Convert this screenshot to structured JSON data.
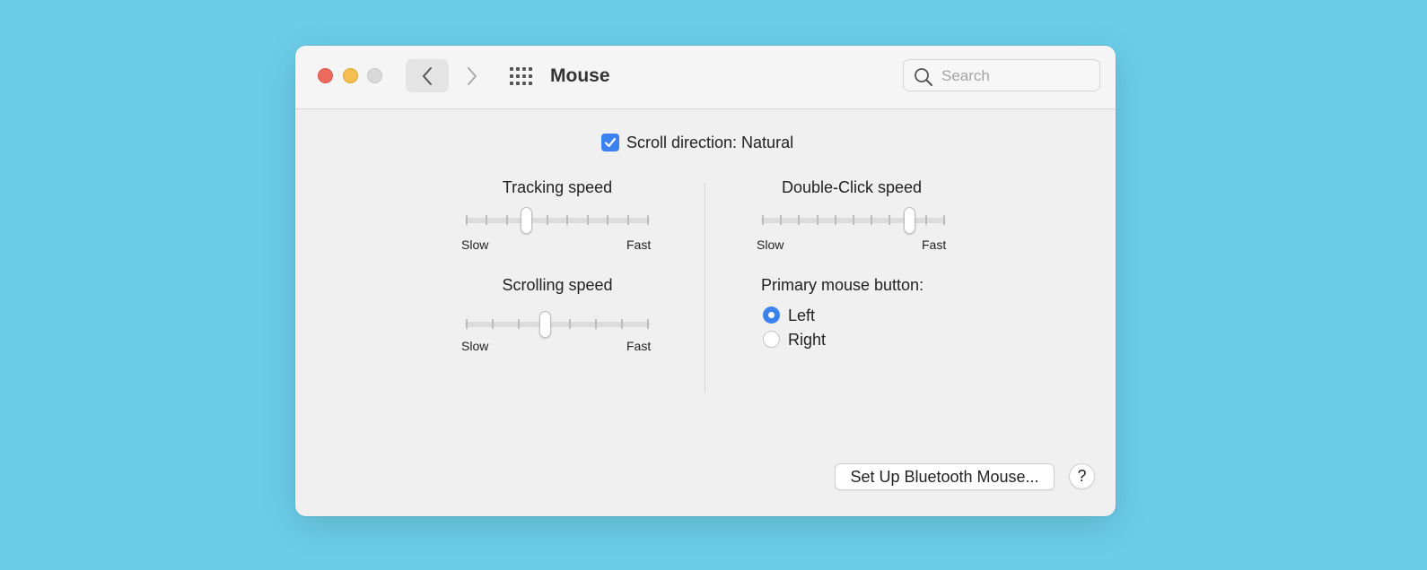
{
  "window": {
    "title": "Mouse",
    "search": {
      "placeholder": "Search",
      "value": ""
    },
    "traffic_lights": [
      "close",
      "minimize",
      "zoom-disabled"
    ],
    "nav": {
      "back_icon": "chevron-left-icon",
      "forward_icon": "chevron-right-icon",
      "show_all_icon": "grid-icon"
    }
  },
  "scroll_direction": {
    "label": "Scroll direction: Natural",
    "checked": true
  },
  "tracking_speed": {
    "label": "Tracking speed",
    "min_label": "Slow",
    "max_label": "Fast",
    "ticks": 10,
    "value_fraction": 0.33
  },
  "scrolling_speed": {
    "label": "Scrolling speed",
    "min_label": "Slow",
    "max_label": "Fast",
    "ticks": 8,
    "value_fraction": 0.43
  },
  "double_click_speed": {
    "label": "Double-Click speed",
    "min_label": "Slow",
    "max_label": "Fast",
    "ticks": 11,
    "value_fraction": 0.8
  },
  "primary_button": {
    "label": "Primary mouse button:",
    "options": [
      {
        "label": "Left",
        "selected": true
      },
      {
        "label": "Right",
        "selected": false
      }
    ]
  },
  "footer": {
    "setup_button": "Set Up Bluetooth Mouse...",
    "help_button": "?"
  },
  "colors": {
    "background": "#6ccde8",
    "accent": "#3b82f0",
    "close": "#ee6a5f",
    "minimize": "#f5be4f",
    "zoom": "#d9d9d9"
  }
}
